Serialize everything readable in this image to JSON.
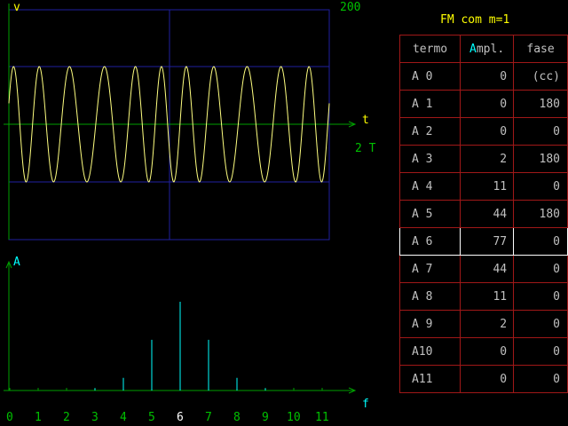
{
  "scope": {
    "y_label": "v",
    "x_label": "t",
    "range_label": "200",
    "time_label": "2 T",
    "carrier_cycles": 11,
    "modulation_index": 1
  },
  "spectrum": {
    "y_label": "A",
    "x_label": "f",
    "tick_labels": [
      "0",
      "1",
      "2",
      "3",
      "4",
      "5",
      "6",
      "7",
      "8",
      "9",
      "10",
      "11"
    ],
    "selected_index": 6
  },
  "panel": {
    "title": "FM com m=1",
    "headers": {
      "term": "termo",
      "ampl_first": "A",
      "ampl_rest": "mpl.",
      "phase": "fase"
    },
    "rows": [
      {
        "term": "A 0",
        "ampl": "0",
        "phase": "(cc)"
      },
      {
        "term": "A 1",
        "ampl": "0",
        "phase": "180"
      },
      {
        "term": "A 2",
        "ampl": "0",
        "phase": "0"
      },
      {
        "term": "A 3",
        "ampl": "2",
        "phase": "180"
      },
      {
        "term": "A 4",
        "ampl": "11",
        "phase": "0"
      },
      {
        "term": "A 5",
        "ampl": "44",
        "phase": "180"
      },
      {
        "term": "A 6",
        "ampl": "77",
        "phase": "0"
      },
      {
        "term": "A 7",
        "ampl": "44",
        "phase": "0"
      },
      {
        "term": "A 8",
        "ampl": "11",
        "phase": "0"
      },
      {
        "term": "A 9",
        "ampl": "2",
        "phase": "0"
      },
      {
        "term": "A10",
        "ampl": "0",
        "phase": "0"
      },
      {
        "term": "A11",
        "ampl": "0",
        "phase": "0"
      }
    ]
  },
  "colors": {
    "axis": "#00a000",
    "grid": "#2020a0",
    "waveform": "#ffff80",
    "spectral_line": "#00ffff",
    "table_border": "#a01818",
    "highlight": "#ffffff",
    "title": "#ffff00"
  }
}
